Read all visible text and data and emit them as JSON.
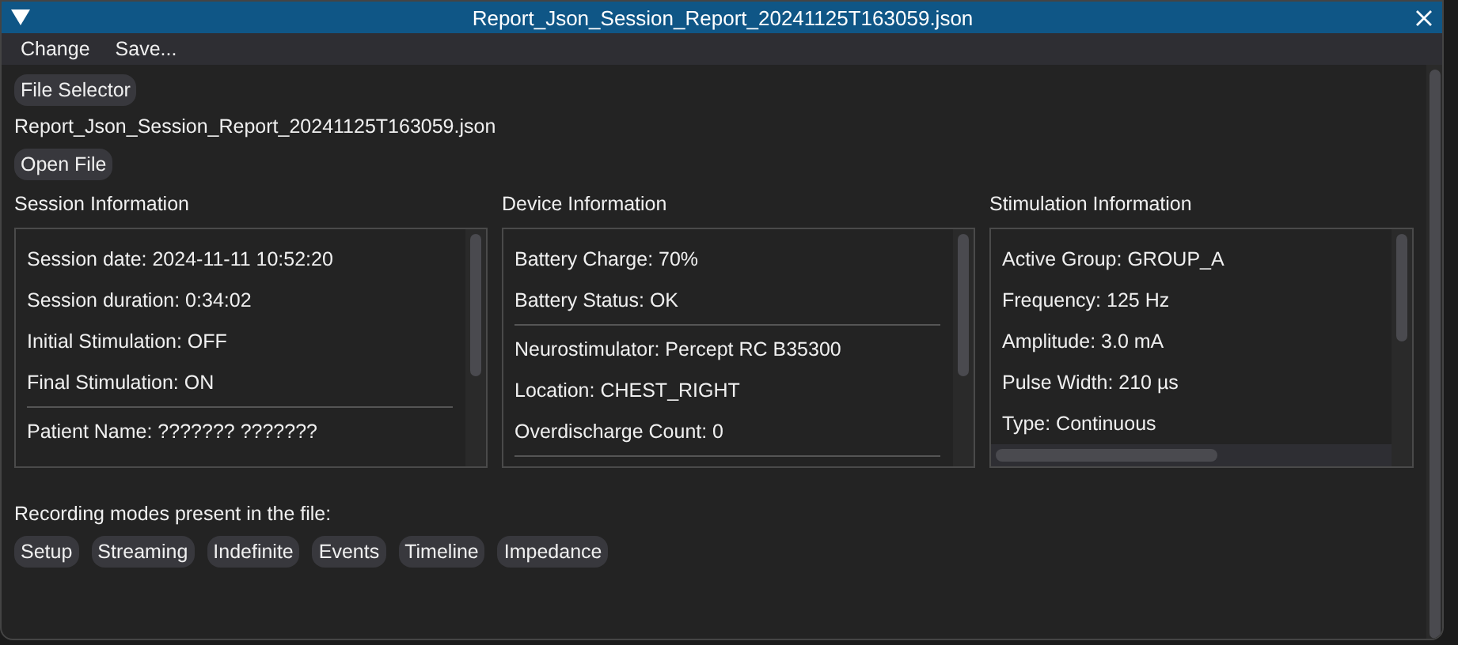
{
  "window": {
    "title": "Report_Json_Session_Report_20241125T163059.json"
  },
  "menu": [
    "Change",
    "Save..."
  ],
  "file_selector_button": "File Selector",
  "file_name": "Report_Json_Session_Report_20241125T163059.json",
  "open_file_button": "Open File",
  "panels": [
    {
      "title": "Session Information",
      "horizontal_scrollbar": false,
      "items": [
        {
          "kind": "text",
          "text": "Session date: 2024-11-11 10:52:20"
        },
        {
          "kind": "text",
          "text": "Session duration: 0:34:02"
        },
        {
          "kind": "text",
          "text": "Initial Stimulation: OFF"
        },
        {
          "kind": "text",
          "text": "Final Stimulation: ON"
        },
        {
          "kind": "separator"
        },
        {
          "kind": "text",
          "text": "Patient Name: ??????? ???????"
        }
      ]
    },
    {
      "title": "Device Information",
      "horizontal_scrollbar": false,
      "items": [
        {
          "kind": "text",
          "text": "Battery Charge: 70%"
        },
        {
          "kind": "text",
          "text": "Battery Status: OK"
        },
        {
          "kind": "separator"
        },
        {
          "kind": "text",
          "text": "Neurostimulator: Percept RC B35300"
        },
        {
          "kind": "text",
          "text": "Location: CHEST_RIGHT"
        },
        {
          "kind": "text",
          "text": "Overdischarge Count: 0"
        },
        {
          "kind": "separator"
        }
      ]
    },
    {
      "title": "Stimulation Information",
      "horizontal_scrollbar": true,
      "items": [
        {
          "kind": "text",
          "text": "Active Group: GROUP_A"
        },
        {
          "kind": "text",
          "text": "Frequency: 125 Hz"
        },
        {
          "kind": "text",
          "text": "Amplitude: 3.0 mA"
        },
        {
          "kind": "text",
          "text": "Pulse Width: 210 µs"
        },
        {
          "kind": "text",
          "text": "Type: Continuous"
        }
      ]
    }
  ],
  "recording_modes_label": "Recording modes present in the file:",
  "recording_modes": [
    "Setup",
    "Streaming",
    "Indefinite",
    "Events",
    "Timeline",
    "Impedance"
  ]
}
